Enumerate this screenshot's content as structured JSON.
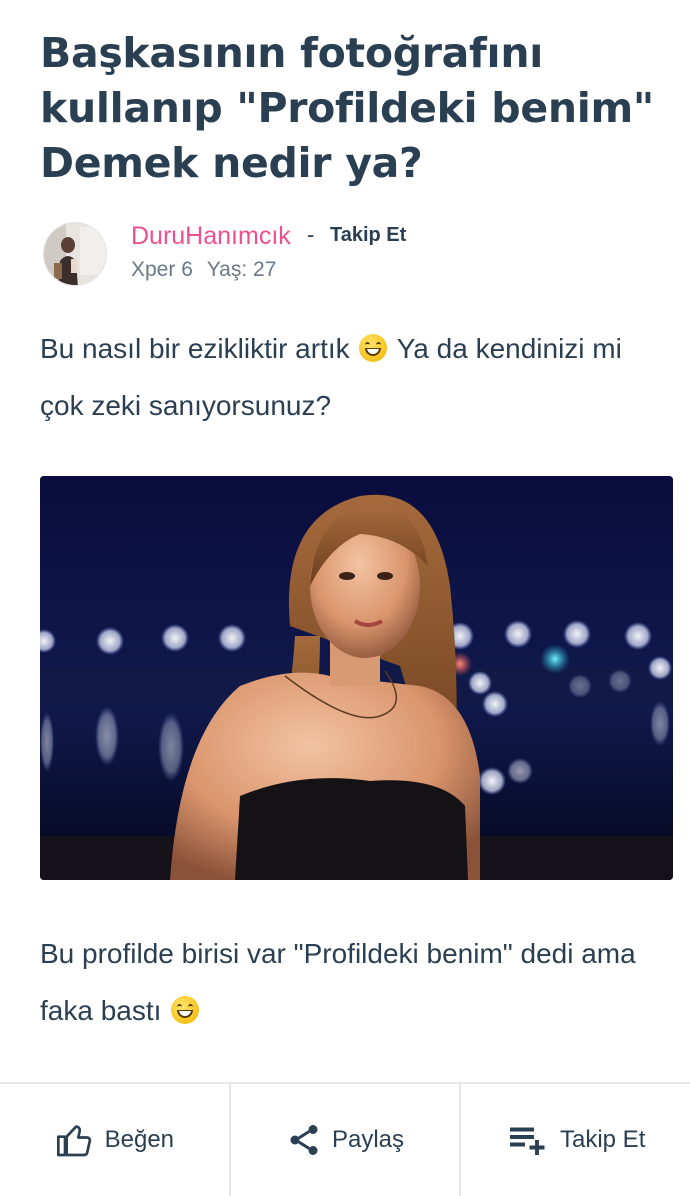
{
  "post": {
    "title": "Başkasının fotoğrafını kullanıp \"Profildeki benim\" Demek nedir ya?",
    "author": {
      "name": "DuruHanımcık",
      "separator": "-",
      "follow_label": "Takip Et",
      "xper": "Xper 6",
      "age": "Yaş: 27"
    },
    "body": [
      {
        "before": "Bu nasıl bir ezikliktir artık ",
        "emoji": "grinning-emoji",
        "after": " Ya da kendinizi mi çok zeki sanıyorsunuz?"
      },
      {
        "before": "Bu profilde birisi var \"Profildeki benim\" dedi ama faka bastı ",
        "emoji": "grinning-emoji",
        "after": ""
      }
    ]
  },
  "actions": {
    "like_label": "Beğen",
    "share_label": "Paylaş",
    "follow_label": "Takip Et"
  },
  "colors": {
    "author_name": "#ef4f91",
    "text": "#2a3f52",
    "meta": "#6b7886",
    "divider": "#e3e6ea"
  }
}
